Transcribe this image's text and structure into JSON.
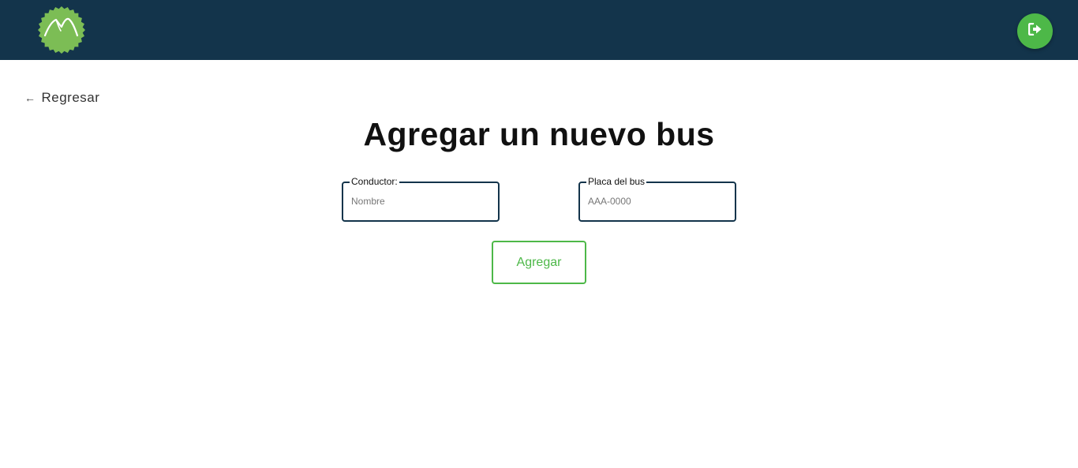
{
  "header": {
    "logo_icon": "mountain-badge-icon",
    "logout_icon": "sign-out-icon",
    "colors": {
      "bar": "#13344b",
      "accent": "#4db848",
      "logo": "#7cbd55"
    }
  },
  "nav": {
    "back_arrow": "←",
    "back_label": "Regresar"
  },
  "page": {
    "title": "Agregar un nuevo bus"
  },
  "form": {
    "driver": {
      "label": "Conductor:",
      "placeholder": "Nombre",
      "value": ""
    },
    "plate": {
      "label": "Placa del bus",
      "placeholder": "AAA-0000",
      "value": ""
    },
    "submit_label": "Agregar"
  }
}
